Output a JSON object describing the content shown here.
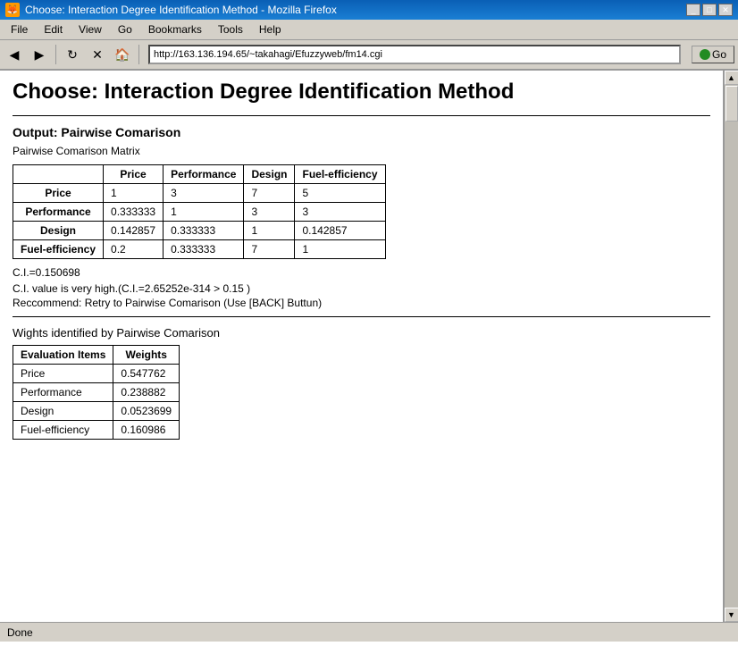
{
  "window": {
    "title": "Choose: Interaction Degree Identification Method - Mozilla Firefox",
    "icon": "🦊"
  },
  "menu": {
    "items": [
      "File",
      "Edit",
      "View",
      "Go",
      "Bookmarks",
      "Tools",
      "Help"
    ]
  },
  "toolbar": {
    "address": "http://163.136.194.65/~takahagi/Efuzzyweb/fm14.cgi",
    "go_label": "Go"
  },
  "page": {
    "title": "Choose: Interaction Degree Identification Method",
    "output_label": "Output: Pairwise Comarison",
    "matrix_label": "Pairwise Comarison Matrix",
    "matrix": {
      "headers": [
        "",
        "Price",
        "Performance",
        "Design",
        "Fuel-efficiency"
      ],
      "rows": [
        [
          "Price",
          "1",
          "3",
          "7",
          "5"
        ],
        [
          "Performance",
          "0.333333",
          "1",
          "3",
          "3"
        ],
        [
          "Design",
          "0.142857",
          "0.333333",
          "1",
          "0.142857"
        ],
        [
          "Fuel-efficiency",
          "0.2",
          "0.333333",
          "7",
          "1"
        ]
      ]
    },
    "ci": "C.I.=0.150698",
    "ci_warning": "C.I. value is very high.(C.I.=2.65252e-314 > 0.15 )",
    "ci_recommend": "Reccommend: Retry to Pairwise Comarison (Use [BACK] Buttun)",
    "weights_title": "Wights identified by Pairwise Comarison",
    "weights_table": {
      "headers": [
        "Evaluation Items",
        "Weights"
      ],
      "rows": [
        [
          "Price",
          "0.547762"
        ],
        [
          "Performance",
          "0.238882"
        ],
        [
          "Design",
          "0.0523699"
        ],
        [
          "Fuel-efficiency",
          "0.160986"
        ]
      ]
    }
  },
  "status": {
    "text": "Done"
  }
}
